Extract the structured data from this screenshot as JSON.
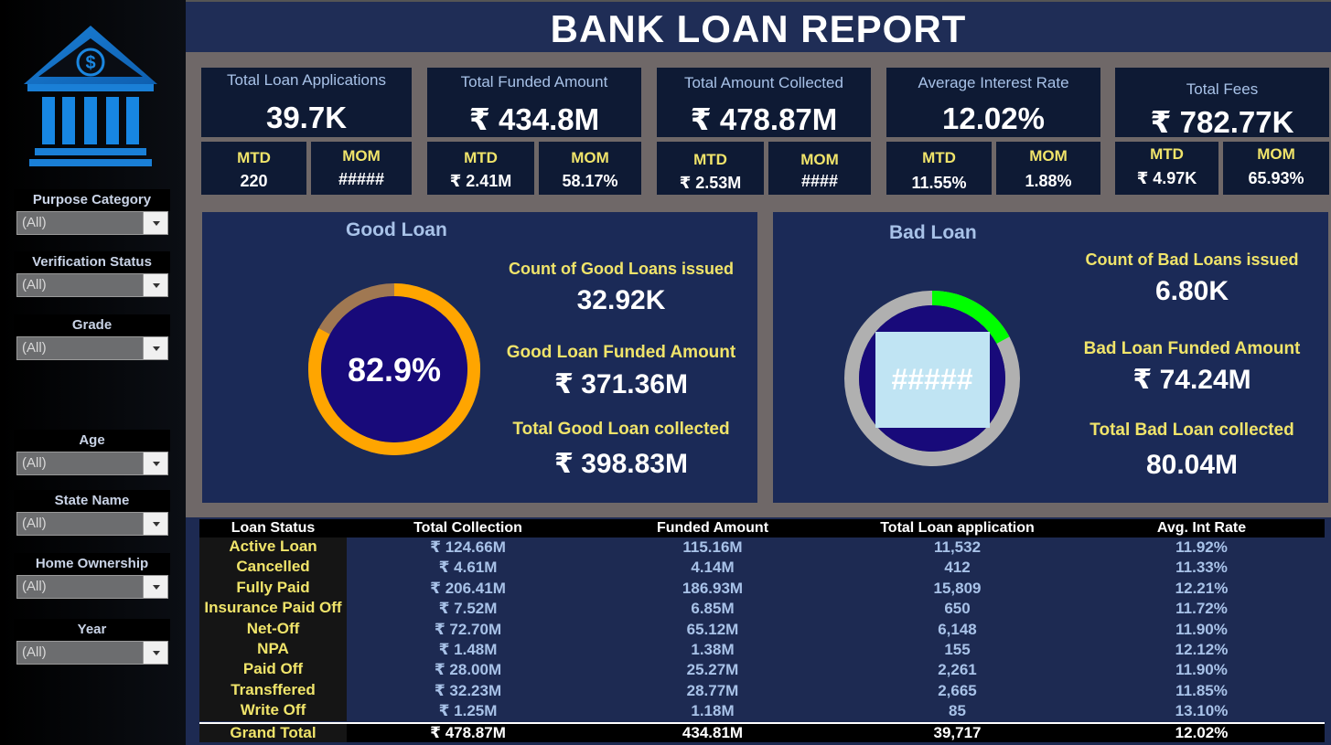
{
  "title": "BANK LOAN REPORT",
  "colors": {
    "accent_yellow": "#f0e46a",
    "label_blue": "#a8c2e8",
    "panel_navy": "#1b2a57",
    "good_ring": "#ffa500",
    "good_ring_rest": "#a07852",
    "bad_ring": "#00ff00",
    "bad_ring_rest": "#b0b0b0"
  },
  "logo": {
    "icon": "bank-icon"
  },
  "filters": [
    {
      "label": "Purpose Category",
      "value": "(All)"
    },
    {
      "label": "Verification Status",
      "value": "(All)"
    },
    {
      "label": "Grade",
      "value": "(All)"
    },
    {
      "label": "Age",
      "value": "(All)"
    },
    {
      "label": "State Name",
      "value": "(All)"
    },
    {
      "label": "Home Ownership",
      "value": "(All)"
    },
    {
      "label": "Year",
      "value": "(All)"
    }
  ],
  "kpis": [
    {
      "label": "Total Loan Applications",
      "value": "39.7K",
      "mtd_label": "MTD",
      "mtd": "220",
      "mom_label": "MOM",
      "mom": "#####"
    },
    {
      "label": "Total Funded Amount",
      "value": "₹ 434.8M",
      "mtd_label": "MTD",
      "mtd": "₹ 2.41M",
      "mom_label": "MOM",
      "mom": "58.17%"
    },
    {
      "label": "Total Amount Collected",
      "value": "₹ 478.87M",
      "mtd_label": "MTD",
      "mtd": "₹ 2.53M",
      "mom_label": "MOM",
      "mom": "####"
    },
    {
      "label": "Average Interest Rate",
      "value": "12.02%",
      "mtd_label": "MTD",
      "mtd": "11.55%",
      "mom_label": "MOM",
      "mom": "1.88%"
    },
    {
      "label": "Total Fees",
      "value": "₹ 782.77K",
      "mtd_label": "MTD",
      "mtd": "₹ 4.97K",
      "mom_label": "MOM",
      "mom": "65.93%"
    }
  ],
  "good_loan": {
    "title": "Good Loan",
    "percent": "82.9%",
    "percent_value": 0.829,
    "count_label": "Count of Good Loans issued",
    "count": "32.92K",
    "funded_label": "Good Loan Funded Amount",
    "funded": "₹ 371.36M",
    "collected_label": "Total Good Loan collected",
    "collected": "₹ 398.83M"
  },
  "bad_loan": {
    "title": "Bad Loan",
    "percent": "#####",
    "percent_value": 0.171,
    "count_label": "Count of Bad Loans issued",
    "count": "6.80K",
    "funded_label": "Bad Loan Funded Amount",
    "funded": "₹ 74.24M",
    "collected_label": "Total Bad Loan collected",
    "collected": "80.04M"
  },
  "table": {
    "headers": [
      "Loan Status",
      "Total Collection",
      "Funded Amount",
      "Total Loan application",
      "Avg. Int Rate"
    ],
    "rows": [
      [
        "Active Loan",
        "₹ 124.66M",
        "115.16M",
        "11,532",
        "11.92%"
      ],
      [
        "Cancelled",
        "₹ 4.61M",
        "4.14M",
        "412",
        "11.33%"
      ],
      [
        "Fully Paid",
        "₹ 206.41M",
        "186.93M",
        "15,809",
        "12.21%"
      ],
      [
        "Insurance Paid Off",
        "₹ 7.52M",
        "6.85M",
        "650",
        "11.72%"
      ],
      [
        "Net-Off",
        "₹ 72.70M",
        "65.12M",
        "6,148",
        "11.90%"
      ],
      [
        "NPA",
        "₹ 1.48M",
        "1.38M",
        "155",
        "12.12%"
      ],
      [
        "Paid Off",
        "₹ 28.00M",
        "25.27M",
        "2,261",
        "11.90%"
      ],
      [
        "Transffered",
        "₹ 32.23M",
        "28.77M",
        "2,665",
        "11.85%"
      ],
      [
        "Write Off",
        "₹ 1.25M",
        "1.18M",
        "85",
        "13.10%"
      ]
    ],
    "total": [
      "Grand Total",
      "₹ 478.87M",
      "434.81M",
      "39,717",
      "12.02%"
    ]
  }
}
